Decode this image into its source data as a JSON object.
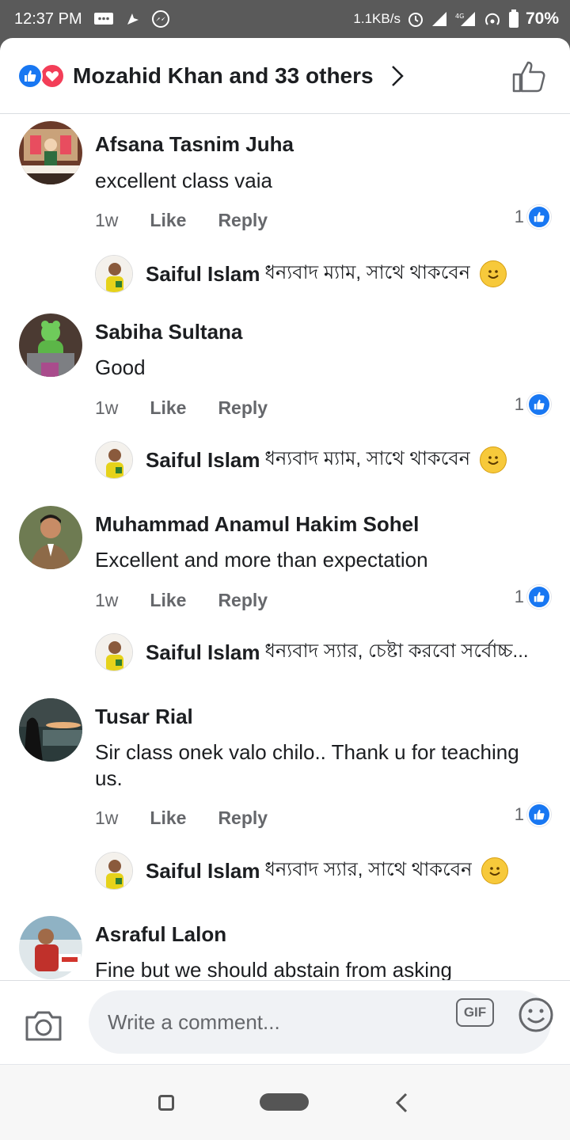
{
  "status_bar": {
    "time": "12:37 PM",
    "net_speed": "1.1KB/s",
    "battery": "70%"
  },
  "reactions": {
    "summary": "Mozahid Khan and 33 others"
  },
  "comments": [
    {
      "name": "Afsana Tasnim Juha",
      "text": "excellent class vaia",
      "time": "1w",
      "like_label": "Like",
      "reply_label": "Reply",
      "likes": "1",
      "reply": {
        "name": "Saiful Islam",
        "text": "ধন্যবাদ ম্যাম, সাথে থাকবেন"
      }
    },
    {
      "name": "Sabiha Sultana",
      "text": "Good",
      "time": "1w",
      "like_label": "Like",
      "reply_label": "Reply",
      "likes": "1",
      "reply": {
        "name": "Saiful Islam",
        "text": "ধন্যবাদ ম্যাম, সাথে থাকবেন"
      }
    },
    {
      "name": "Muhammad Anamul Hakim Sohel",
      "text": "Excellent and more than expectation",
      "time": "1w",
      "like_label": "Like",
      "reply_label": "Reply",
      "likes": "1",
      "reply": {
        "name": "Saiful Islam",
        "text": "ধন্যবাদ স্যার, চেষ্টা করবো সর্বোচ্চ..."
      }
    },
    {
      "name": "Tusar Rial",
      "text": "Sir class onek valo chilo.. Thank u for teaching us.",
      "time": "1w",
      "like_label": "Like",
      "reply_label": "Reply",
      "likes": "1",
      "reply": {
        "name": "Saiful Islam",
        "text": "ধন্যবাদ স্যার, সাথে থাকবেন"
      }
    },
    {
      "name": "Asraful Lalon",
      "text": "Fine but we should abstain from asking"
    }
  ],
  "composer": {
    "placeholder": "Write a comment...",
    "gif_label": "GIF"
  },
  "colors": {
    "accent": "#1877f2",
    "love": "#f33e58",
    "muted_text": "#65676b"
  }
}
